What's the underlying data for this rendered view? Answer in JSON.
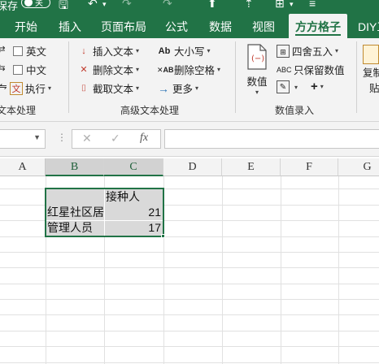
{
  "titlebar": {
    "partial_text": "保存",
    "toggle_label": "关"
  },
  "tabs": [
    "开始",
    "插入",
    "页面布局",
    "公式",
    "数据",
    "视图",
    "方方格子",
    "DIY工"
  ],
  "active_tab": "方方格子",
  "ribbon": {
    "left_group": {
      "items": [
        "英文",
        "中文",
        "执行"
      ],
      "label": "文本处理"
    },
    "advanced_text": {
      "items": [
        "插入文本",
        "删除文本",
        "截取文本",
        "大小写",
        "删除空格",
        "更多"
      ],
      "label": "高级文本处理"
    },
    "number_entry": {
      "big_button": "数值",
      "items": [
        "四舍五入",
        "只保留数值"
      ],
      "plus": "+",
      "label": "数值录入"
    },
    "right_partial": {
      "label1": "复制",
      "label2": "贴"
    }
  },
  "formula_bar": {
    "name_box": "",
    "cancel": "✕",
    "enter": "✓",
    "fx": "fx",
    "content": ""
  },
  "columns": [
    "A",
    "B",
    "C",
    "D",
    "E",
    "F",
    "G"
  ],
  "selected_columns": [
    "B",
    "C"
  ],
  "cells": {
    "header_c": "接种人",
    "row1_label": "红星社区居民",
    "row1_value": "21",
    "row2_label": "管理人员",
    "row2_value": "17"
  },
  "colors": {
    "accent": "#217346",
    "selection_fill": "#d9d9d9"
  }
}
